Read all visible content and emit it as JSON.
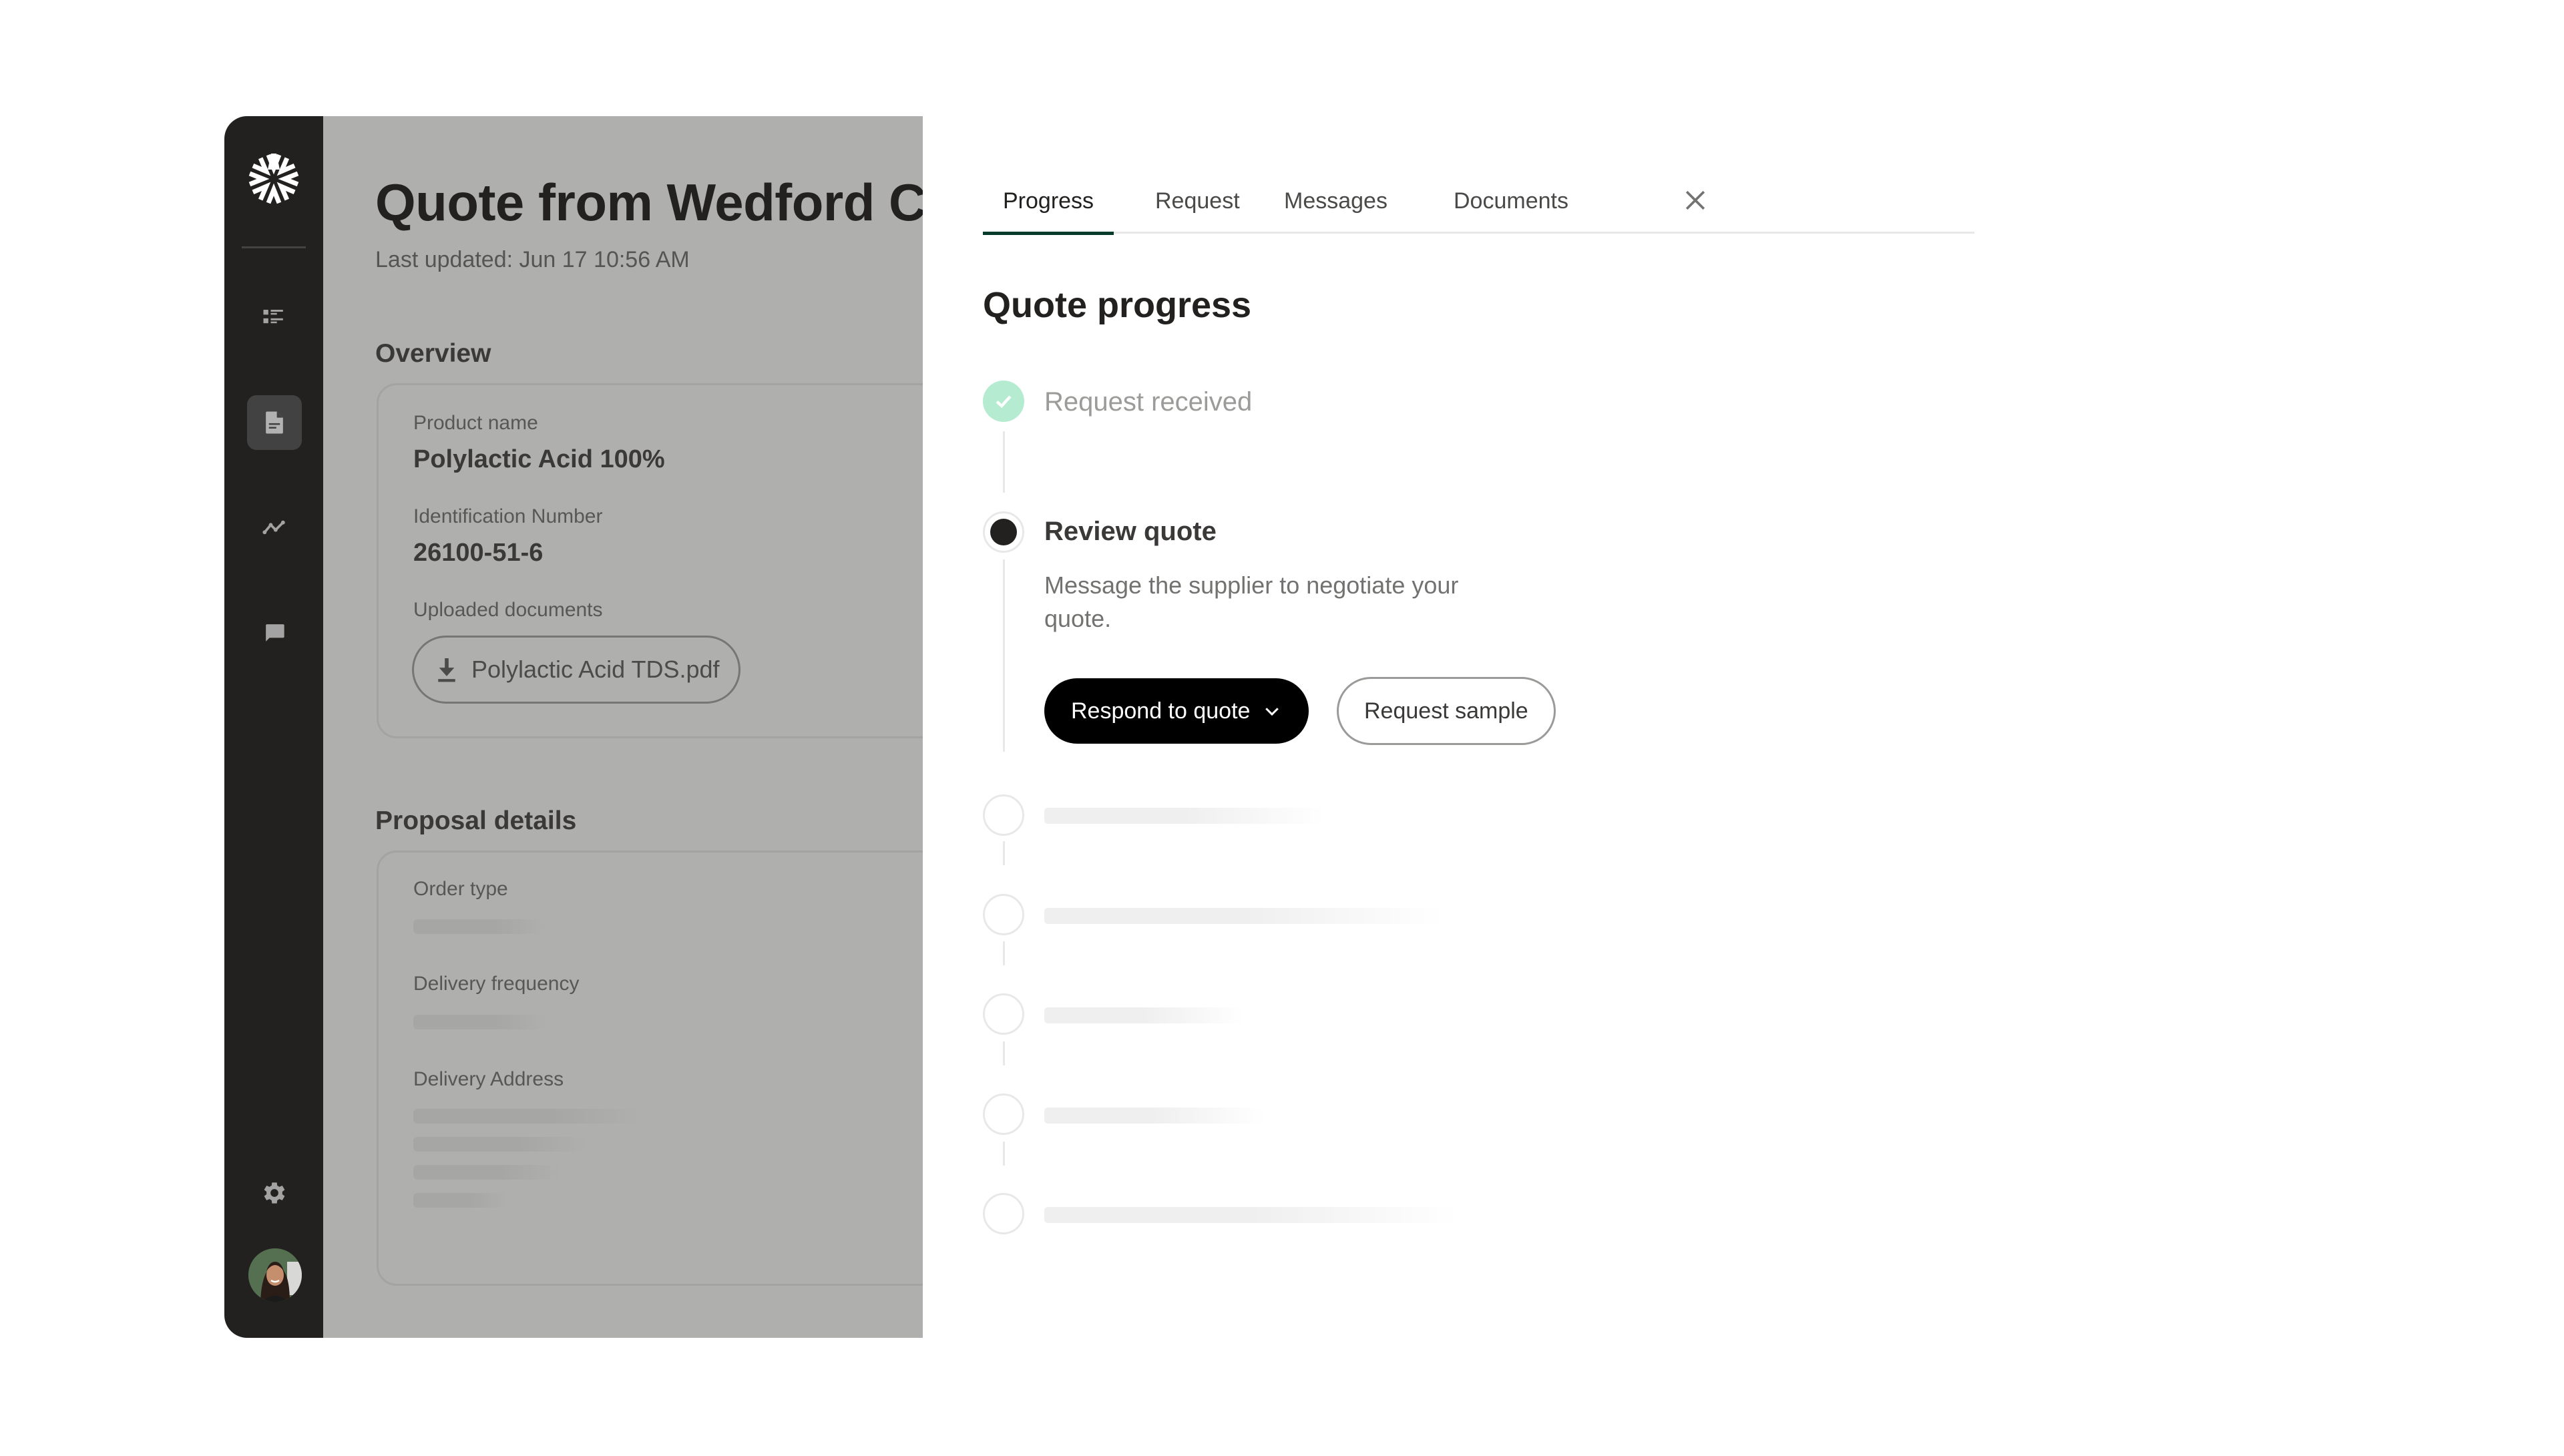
{
  "sidebar": {
    "logo_icon": "starburst-logo",
    "items": [
      {
        "icon": "list-icon",
        "active": false
      },
      {
        "icon": "document-icon",
        "active": true
      },
      {
        "icon": "trend-line-icon",
        "active": false
      },
      {
        "icon": "chat-bubble-icon",
        "active": false
      }
    ],
    "settings_icon": "gear-icon",
    "avatar_icon": "user-avatar"
  },
  "main": {
    "title": "Quote from Wedford Chemicals",
    "last_updated": "Last updated: Jun 17 10:56 AM",
    "overview": {
      "heading": "Overview",
      "product_name_label": "Product name",
      "product_name_value": "Polylactic Acid 100%",
      "id_label": "Identification Number",
      "id_value": "26100-51-6",
      "docs_label": "Uploaded documents",
      "doc_name": "Polylactic Acid TDS.pdf"
    },
    "proposal": {
      "heading": "Proposal details",
      "order_type_label": "Order type",
      "delivery_frequency_label": "Delivery frequency",
      "delivery_address_label": "Delivery Address"
    }
  },
  "drawer": {
    "tabs": [
      {
        "label": "Progress",
        "active": true
      },
      {
        "label": "Request",
        "active": false
      },
      {
        "label": "Messages",
        "active": false
      },
      {
        "label": "Documents",
        "active": false
      }
    ],
    "title": "Quote progress",
    "steps": [
      {
        "label": "Request received",
        "status": "done"
      },
      {
        "label": "Review quote",
        "status": "current",
        "description": "Message the supplier to negotiate your quote."
      },
      {
        "label": "",
        "status": "pending"
      },
      {
        "label": "",
        "status": "pending"
      },
      {
        "label": "",
        "status": "pending"
      },
      {
        "label": "",
        "status": "pending"
      },
      {
        "label": "",
        "status": "pending"
      }
    ],
    "primary_button": "Respond to quote",
    "secondary_button": "Request sample"
  },
  "colors": {
    "sidebar_bg": "#222120",
    "overlay_bg": "#afafad",
    "tab_accent": "#063a2b",
    "step_done": "#b5ecd1",
    "primary_button": "#000000"
  }
}
